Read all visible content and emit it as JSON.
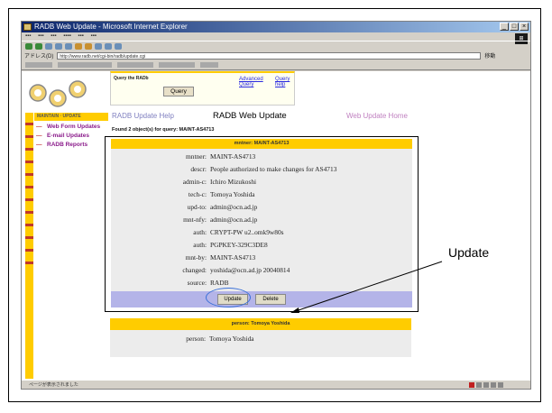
{
  "browser": {
    "title": "RADB Web Update - Microsoft Internet Explorer",
    "address_label": "アドレス(D)",
    "address": "http://www.radb.net/cgi-bin/radb/update.cgi",
    "go_label": "移動"
  },
  "query": {
    "title": "Query the RADb",
    "button_label": "Query",
    "advanced_link": "Advanced Query",
    "help_link": "Query help"
  },
  "nav": {
    "help_link": "RADB Update Help",
    "title": "RADB Web Update",
    "home_link": "Web Update Home"
  },
  "sidebar": {
    "header": "MAINTAIN · UPDATE",
    "links": [
      "Web Form Updates",
      "E-mail Updates",
      "RADB Reports"
    ]
  },
  "found_text": "Found 2 object(s) for query: MAINT-AS4713",
  "record": {
    "header": "mntner: MAINT-AS4713",
    "fields": [
      {
        "key": "mntner:",
        "value": "MAINT-AS4713"
      },
      {
        "key": "descr:",
        "value": "People authorized to make changes for AS4713"
      },
      {
        "key": "admin-c:",
        "value": "Ichiro Mizukoshi"
      },
      {
        "key": "tech-c:",
        "value": "Tomoya Yoshida"
      },
      {
        "key": "upd-to:",
        "value": "admin@ocn.ad.jp"
      },
      {
        "key": "mnt-nfy:",
        "value": "admin@ocn.ad.jp"
      },
      {
        "key": "auth:",
        "value": "CRYPT-PW u2..omk9w80s"
      },
      {
        "key": "auth:",
        "value": "PGPKEY-329C3DE8"
      },
      {
        "key": "mnt-by:",
        "value": "MAINT-AS4713"
      },
      {
        "key": "changed:",
        "value": "yoshida@ocn.ad.jp 20040814"
      },
      {
        "key": "source:",
        "value": "RADB"
      }
    ],
    "update_button": "Update",
    "delete_button": "Delete"
  },
  "person": {
    "header": "person: Tomoya Yoshida",
    "key": "person:",
    "value": "Tomoya Yoshida"
  },
  "status_text": "ページが表示されました",
  "annotation": {
    "label": "Update"
  },
  "colors": {
    "accent": "#ffcc00",
    "footer_bar": "#b4b4e8",
    "highlight": "#3a70d8"
  }
}
